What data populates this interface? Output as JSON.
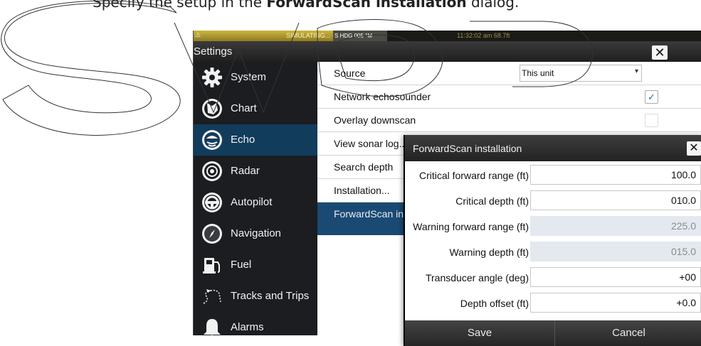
{
  "caption": {
    "prefix": "Specify the setup in the ",
    "bold": "ForwardScan installation",
    "suffix": " dialog."
  },
  "statusbar": {
    "alarm_text": "SIMULATING...",
    "heading": "HDG 005 °M",
    "heading_prefix": "S",
    "time": "11:32:02 am   68.7ft"
  },
  "window": {
    "title": "Settings",
    "close": "✕"
  },
  "sidebar": {
    "items": [
      {
        "label": "System",
        "icon": "gear-icon"
      },
      {
        "label": "Chart",
        "icon": "chart-icon"
      },
      {
        "label": "Echo",
        "icon": "echo-icon",
        "selected": true
      },
      {
        "label": "Radar",
        "icon": "radar-icon"
      },
      {
        "label": "Autopilot",
        "icon": "steering-wheel-icon"
      },
      {
        "label": "Navigation",
        "icon": "compass-icon"
      },
      {
        "label": "Fuel",
        "icon": "fuel-pump-icon"
      },
      {
        "label": "Tracks and Trips",
        "icon": "tracks-icon"
      },
      {
        "label": "Alarms",
        "icon": "bell-icon"
      }
    ]
  },
  "main": {
    "rows": [
      {
        "label": "Source",
        "control": "select",
        "value": "This unit"
      },
      {
        "label": "Network echosounder",
        "control": "checkbox",
        "checked": true
      },
      {
        "label": "Overlay downscan",
        "control": "checkbox",
        "checked": false
      },
      {
        "label": "View sonar log..."
      },
      {
        "label": "Search depth"
      },
      {
        "label": "Installation..."
      },
      {
        "label": "ForwardScan installation...",
        "selected": true
      }
    ]
  },
  "dialog": {
    "title": "ForwardScan installation",
    "close": "✕",
    "fields": [
      {
        "label": "Critical forward range (ft)",
        "value": "100.0",
        "disabled": false
      },
      {
        "label": "Critical depth (ft)",
        "value": "010.0",
        "disabled": false
      },
      {
        "label": "Warning forward range (ft)",
        "value": "225.0",
        "disabled": true
      },
      {
        "label": "Warning depth (ft)",
        "value": "015.0",
        "disabled": true
      },
      {
        "label": "Transducer angle (deg)",
        "value": "+00",
        "disabled": false
      },
      {
        "label": "Depth offset (ft)",
        "value": "+0.0",
        "disabled": false
      }
    ],
    "save_label": "Save",
    "cancel_label": "Cancel"
  },
  "colors": {
    "selected_item": "#123c5c",
    "selected_row": "#1a4a73",
    "check": "#1a6fb5",
    "disabled_field": "#e3e9ef"
  }
}
